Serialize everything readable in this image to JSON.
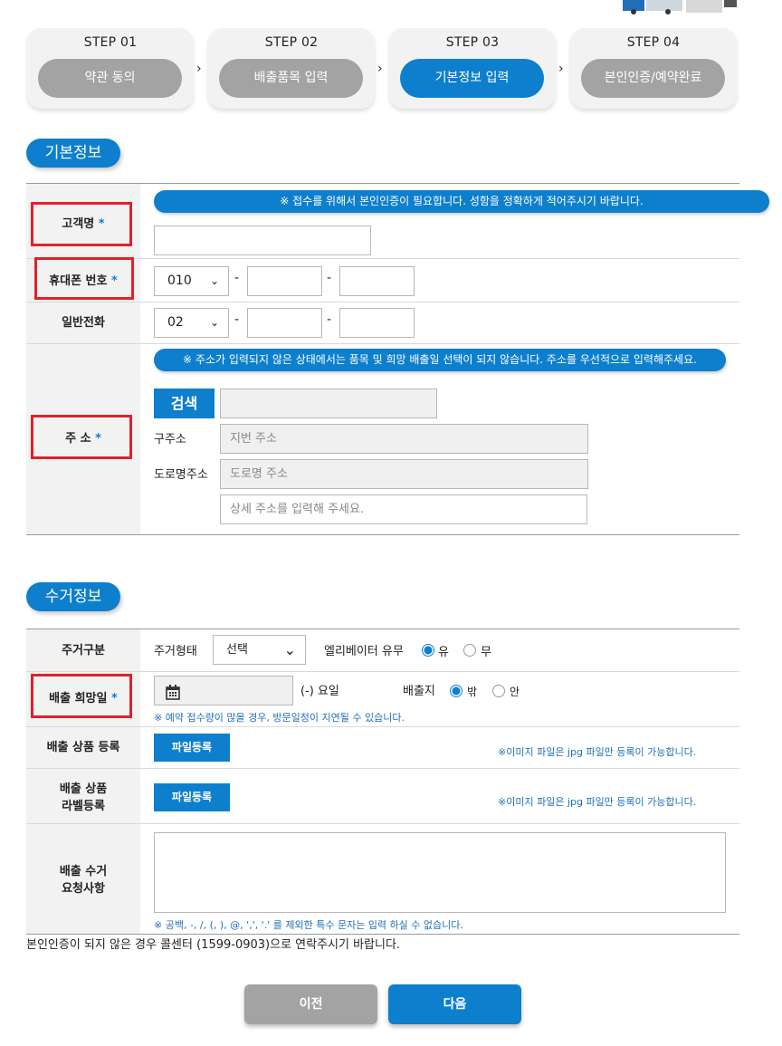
{
  "steps": [
    {
      "title": "STEP 01",
      "label": "약관 동의",
      "active": false
    },
    {
      "title": "STEP 02",
      "label": "배출품목 입력",
      "active": false
    },
    {
      "title": "STEP 03",
      "label": "기본정보 입력",
      "active": true
    },
    {
      "title": "STEP 04",
      "label": "본인인증/예약완료",
      "active": false
    }
  ],
  "step_arrow": "›",
  "basic": {
    "title": "기본정보",
    "name": {
      "label": "고객명",
      "required": "*",
      "notice": "※ 접수를 위해서 본인인증이 필요합니다. 성함을 정확하게 적어주시기 바랍니다."
    },
    "mobile": {
      "label": "휴대폰 번호",
      "required": "*",
      "prefix": "010"
    },
    "phone": {
      "label": "일반전화",
      "prefix": "02"
    },
    "dash": "-",
    "address": {
      "label": "주 소",
      "required": "*",
      "notice": "※ 주소가 입력되지 않은 상태에서는 품목 및 희망 배출일 선택이 되지 않습니다. 주소를 우선적으로 입력해주세요.",
      "search_button": "검색",
      "old_label": "구주소",
      "old_placeholder": "지번 주소",
      "road_label": "도로명주소",
      "road_placeholder": "도로명 주소",
      "detail_placeholder": "상세 주소를 입력해 주세요."
    }
  },
  "pickup": {
    "title": "수거정보",
    "residence": {
      "label": "주거구분",
      "type_label": "주거형태",
      "type_value": "선택",
      "elevator_label": "엘리베이터 유무",
      "opt_yes": "유",
      "opt_no": "무"
    },
    "date": {
      "label": "배출 희망일",
      "required": "*",
      "weekday_text": "(-) 요일",
      "place_label": "배출지",
      "opt_out": "밖",
      "opt_in": "안",
      "note": "※ 예약 접수량이 많을 경우, 방문일정이 지연될 수 있습니다."
    },
    "product_reg": {
      "label": "배출 상품 등록",
      "button": "파일등록",
      "note": "※이미지 파일은 jpg 파일만 등록이 가능합니다."
    },
    "label_reg": {
      "label_line1": "배출 상품",
      "label_line2": "라벨등록",
      "button": "파일등록",
      "note": "※이미지 파일은 jpg 파일만 등록이 가능합니다."
    },
    "request": {
      "label_line1": "배출 수거",
      "label_line2": "요청사항",
      "note": "※ 공백, -, /, (, ), @, ',', '.' 를 제외한 특수 문자는 입력 하실 수 없습니다."
    }
  },
  "contact_notice": "본인인증이 되지 않은 경우 콜센터 (1599-0903)으로 연락주시기 바랍니다.",
  "buttons": {
    "prev": "이전",
    "next": "다음"
  },
  "colors": {
    "accent": "#0e7fcc",
    "inactive": "#a3a3a3",
    "highlight": "#e3202a"
  }
}
